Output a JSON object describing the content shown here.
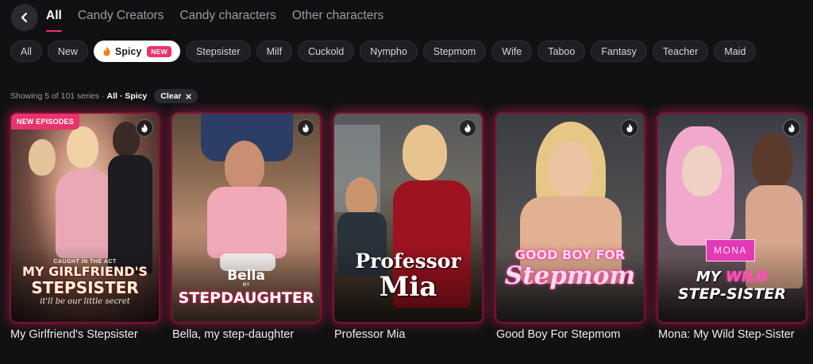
{
  "header": {
    "tabs": [
      {
        "label": "All"
      },
      {
        "label": "Candy Creators"
      },
      {
        "label": "Candy characters"
      },
      {
        "label": "Other characters"
      }
    ]
  },
  "chips": [
    {
      "label": "All"
    },
    {
      "label": "New"
    },
    {
      "label": "Spicy",
      "badge": "NEW"
    },
    {
      "label": "Stepsister"
    },
    {
      "label": "Milf"
    },
    {
      "label": "Cuckold"
    },
    {
      "label": "Nympho"
    },
    {
      "label": "Stepmom"
    },
    {
      "label": "Wife"
    },
    {
      "label": "Taboo"
    },
    {
      "label": "Fantasy"
    },
    {
      "label": "Teacher"
    },
    {
      "label": "Maid"
    }
  ],
  "filter": {
    "showing": "Showing 5 of 101 series ·",
    "active": "All · Spicy",
    "clear_label": "Clear"
  },
  "cards": [
    {
      "title": "My Girlfriend's Stepsister",
      "badge": "NEW EPISODES",
      "poster_kicker": "CAUGHT IN THE ACT",
      "poster_line1": "MY GIRLFRIEND'S",
      "poster_line2": "STEPSISTER",
      "poster_tagline": "it'll be our little secret"
    },
    {
      "title": "Bella, my step-daughter",
      "poster_line1": "Bella",
      "poster_small": "MY",
      "poster_line2": "STEPDAUGHTER"
    },
    {
      "title": "Professor Mia",
      "poster_line1": "Professor",
      "poster_line2": "Mia"
    },
    {
      "title": "Good Boy For Stepmom",
      "poster_line1": "GOOD BOY FOR",
      "poster_line2": "Stepmom"
    },
    {
      "title": "Mona: My Wild Step-Sister",
      "poster_tag": "MONA",
      "poster_line1a": "MY",
      "poster_line1b": "WILD",
      "poster_line2": "STEP-SISTER"
    }
  ],
  "colors": {
    "accent": "#e8336b",
    "background": "#111114",
    "card_glow": "#dc1e5a"
  }
}
